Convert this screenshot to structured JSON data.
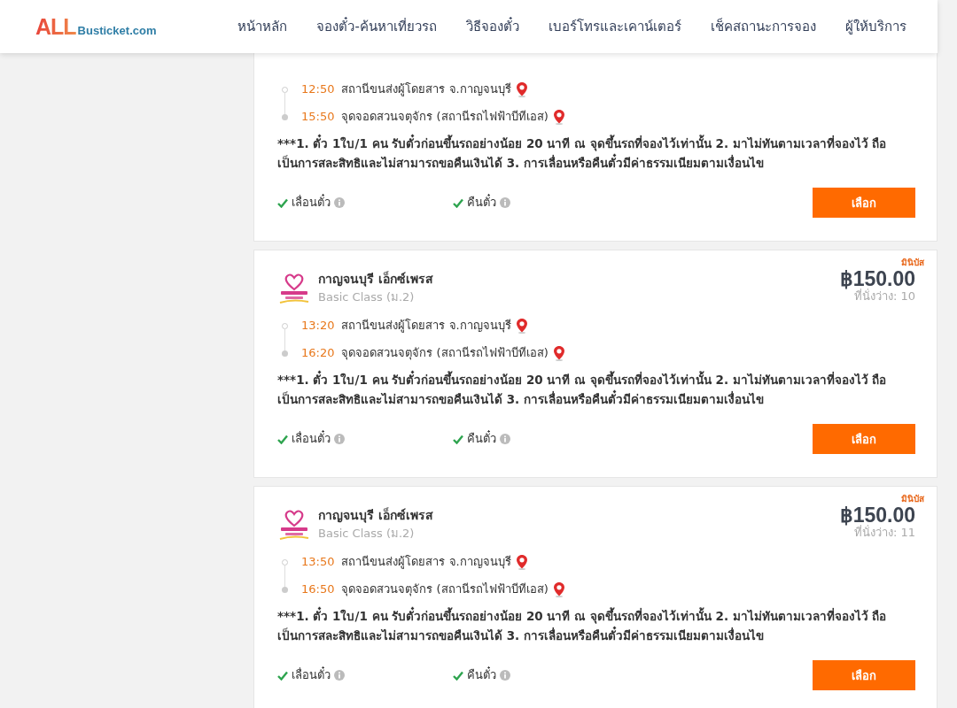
{
  "header": {
    "logo": {
      "brand": "ALL",
      "domain": "Busticket.com"
    },
    "nav": [
      "หน้าหลัก",
      "จองตั๋ว-ค้นหาเที่ยวรถ",
      "วิธีจองตั๋ว",
      "เบอร์โทรและเคาน์เตอร์",
      "เช็คสถานะการจอง",
      "ผู้ให้บริการ"
    ]
  },
  "trips": [
    {
      "stops": [
        {
          "kind": "origin",
          "time": "12:50",
          "place": "สถานีขนส่งผู้โดยสาร จ.กาญจนบุรี"
        },
        {
          "kind": "destination",
          "time": "15:50",
          "place": "จุดจอดสวนจตุจักร (สถานีรถไฟฟ้าบีทีเอส)"
        }
      ],
      "note": "***1. ตั๋ว 1ใบ/1 คน รับตั๋วก่อนขึ้นรถอย่างน้อย 20 นาที ณ จุดขึ้นรถที่จองไว้เท่านั้น 2. มาไม่ทันตามเวลาที่จองไว้ ถือเป็นการสละสิทธิและไม่สามารถขอคืนเงินได้ 3. การเลื่อนหรือคืนตั๋วมีค่าธรรมเนียมตามเงื่อนไข",
      "features": [
        {
          "label": "เลื่อนตั๋ว",
          "available": true
        },
        {
          "label": "คืนตั๋ว",
          "available": true
        }
      ],
      "button": "เลือก"
    },
    {
      "badge": "มินิบัส",
      "operator": "กาญจนบุรี เอ็กซ์เพรส",
      "class": "Basic Class (ม.2)",
      "price": "฿150.00",
      "seats": "ที่นั่งว่าง: 10",
      "stops": [
        {
          "kind": "origin",
          "time": "13:20",
          "place": "สถานีขนส่งผู้โดยสาร จ.กาญจนบุรี"
        },
        {
          "kind": "destination",
          "time": "16:20",
          "place": "จุดจอดสวนจตุจักร (สถานีรถไฟฟ้าบีทีเอส)"
        }
      ],
      "note": "***1. ตั๋ว 1ใบ/1 คน รับตั๋วก่อนขึ้นรถอย่างน้อย 20 นาที ณ จุดขึ้นรถที่จองไว้เท่านั้น 2. มาไม่ทันตามเวลาที่จองไว้ ถือเป็นการสละสิทธิและไม่สามารถขอคืนเงินได้ 3. การเลื่อนหรือคืนตั๋วมีค่าธรรมเนียมตามเงื่อนไข",
      "features": [
        {
          "label": "เลื่อนตั๋ว",
          "available": true
        },
        {
          "label": "คืนตั๋ว",
          "available": true
        }
      ],
      "button": "เลือก"
    },
    {
      "badge": "มินิบัส",
      "operator": "กาญจนบุรี เอ็กซ์เพรส",
      "class": "Basic Class (ม.2)",
      "price": "฿150.00",
      "seats": "ที่นั่งว่าง: 11",
      "stops": [
        {
          "kind": "origin",
          "time": "13:50",
          "place": "สถานีขนส่งผู้โดยสาร จ.กาญจนบุรี"
        },
        {
          "kind": "destination",
          "time": "16:50",
          "place": "จุดจอดสวนจตุจักร (สถานีรถไฟฟ้าบีทีเอส)"
        }
      ],
      "note": "***1. ตั๋ว 1ใบ/1 คน รับตั๋วก่อนขึ้นรถอย่างน้อย 20 นาที ณ จุดขึ้นรถที่จองไว้เท่านั้น 2. มาไม่ทันตามเวลาที่จองไว้ ถือเป็นการสละสิทธิและไม่สามารถขอคืนเงินได้ 3. การเลื่อนหรือคืนตั๋วมีค่าธรรมเนียมตามเงื่อนไข",
      "features": [
        {
          "label": "เลื่อนตั๋ว",
          "available": true
        },
        {
          "label": "คืนตั๋ว",
          "available": true
        }
      ],
      "button": "เลือก"
    }
  ]
}
